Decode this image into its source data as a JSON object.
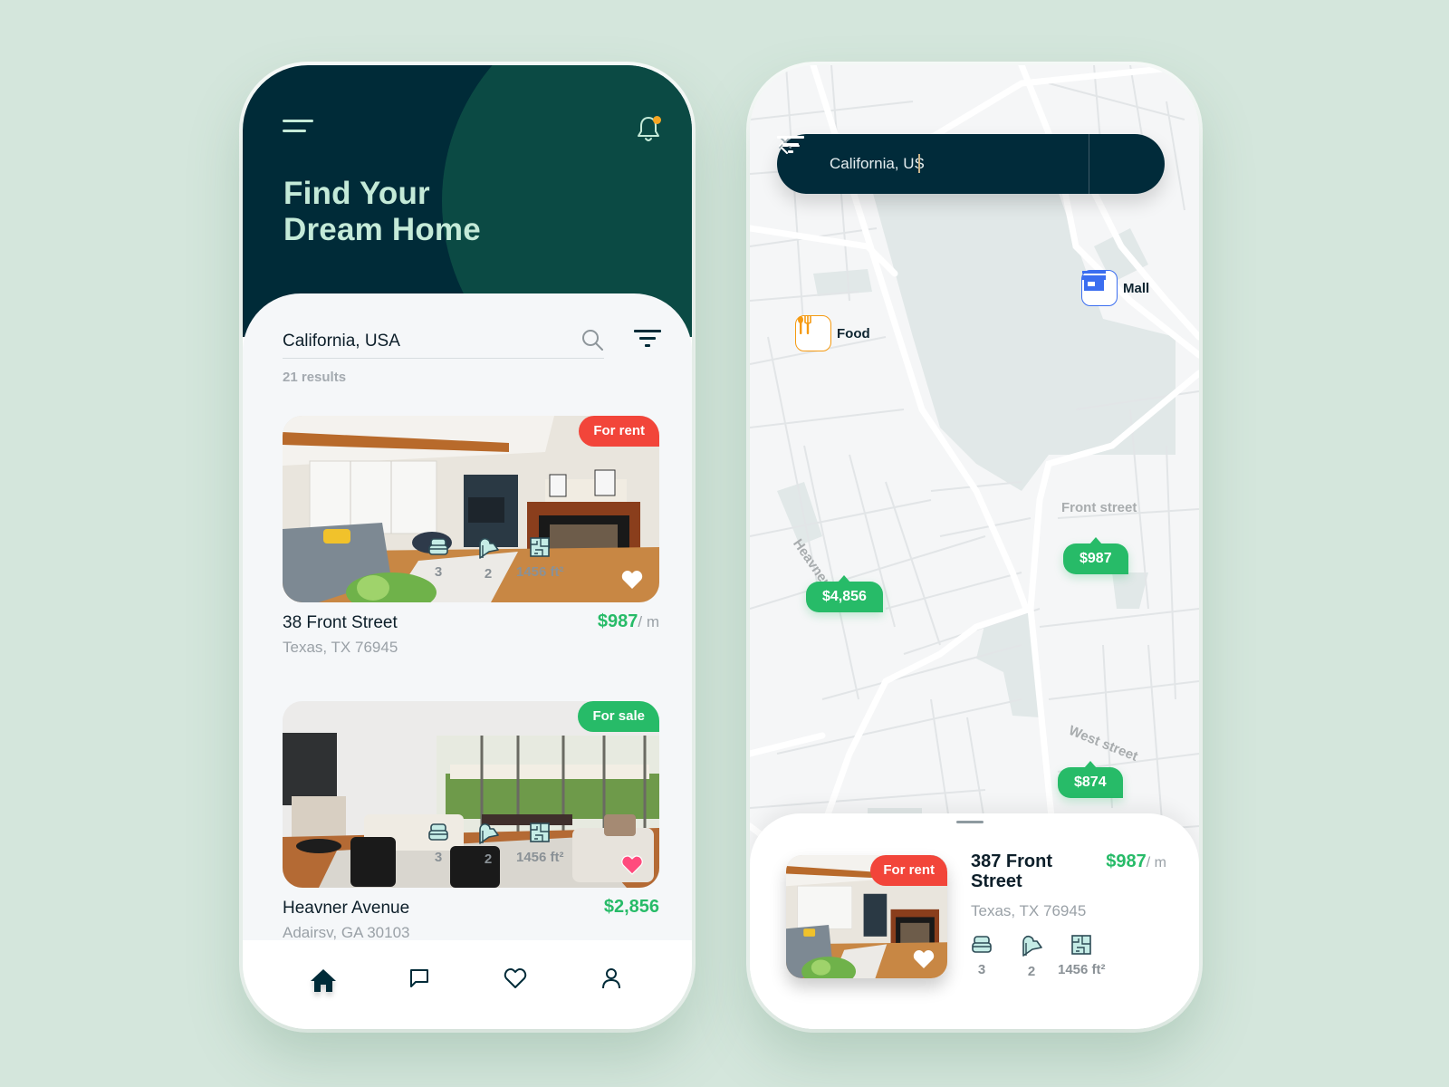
{
  "colors": {
    "background": "#d4e6dc",
    "hero_dark": "#002b38",
    "hero_blob": "#0b4a44",
    "accent_mint": "#c4ead8",
    "green": "#27bb68",
    "red": "#f2453a",
    "notification_dot": "#f6a623",
    "food_orange": "#f59a12",
    "mall_blue": "#3b6ef0",
    "favorite_pink": "#ff4b7d"
  },
  "left_phone": {
    "header": {
      "menu_icon": "hamburger-menu-icon",
      "notification_icon": "bell-icon",
      "has_notification": true,
      "title": "Find Your\nDream Home"
    },
    "search": {
      "value": "California, USA",
      "search_icon": "search-icon",
      "filter_icon": "filter-icon",
      "results": "21 results"
    },
    "listings": [
      {
        "badge": "For rent",
        "badge_type": "rent",
        "favorite": false,
        "title": "38 Front Street",
        "address": "Texas, TX 76945",
        "beds": "3",
        "baths": "2",
        "area": "1456 ft²",
        "price": "$987",
        "period": "/ m"
      },
      {
        "badge": "For sale",
        "badge_type": "sale",
        "favorite": true,
        "title": "Heavner Avenue",
        "address": "Adairsv, GA 30103",
        "beds": "3",
        "baths": "2",
        "area": "1456 ft²",
        "price": "$2,856",
        "period": ""
      }
    ],
    "tabbar": [
      {
        "name": "home",
        "icon": "home-icon",
        "active": true
      },
      {
        "name": "messages",
        "icon": "chat-bubble-icon",
        "active": false
      },
      {
        "name": "favorites",
        "icon": "heart-icon",
        "active": false
      },
      {
        "name": "profile",
        "icon": "user-icon",
        "active": false
      }
    ]
  },
  "right_phone": {
    "search": {
      "back_icon": "arrow-left-icon",
      "value": "California, US",
      "clear_icon": "close-icon",
      "filter_icon": "filter-icon"
    },
    "pois": [
      {
        "label": "Food",
        "icon": "fork-knife-icon"
      },
      {
        "label": "Mall",
        "icon": "store-icon"
      }
    ],
    "street_labels": [
      "Heavner",
      "Front street",
      "West street"
    ],
    "price_pins": [
      "$4,856",
      "$987",
      "$874"
    ],
    "selected_listing": {
      "badge": "For rent",
      "favorite": false,
      "title": "387  Front Street",
      "address": "Texas, TX 76945",
      "beds": "3",
      "baths": "2",
      "area": "1456 ft²",
      "price": "$987",
      "period": "/ m"
    }
  }
}
